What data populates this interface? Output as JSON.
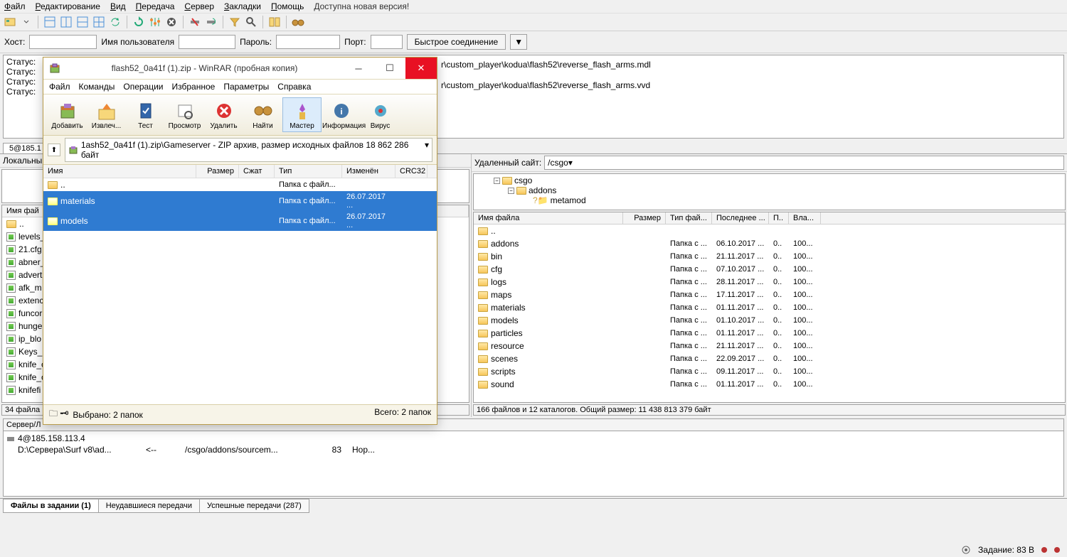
{
  "menu": {
    "file": "Файл",
    "edit": "Редактирование",
    "view": "Вид",
    "transfer": "Передача",
    "server": "Сервер",
    "bookmarks": "Закладки",
    "help": "Помощь",
    "update": "Доступна новая версия!"
  },
  "conn": {
    "host": "Хост:",
    "user": "Имя пользователя",
    "pass": "Пароль:",
    "port": "Порт:",
    "quick": "Быстрое соединение"
  },
  "status": {
    "l0": "Статус:",
    "l1": "Статус:",
    "l2": "Статус:",
    "l3": "Статус:",
    "r0": "r\\custom_player\\kodua\\flash52\\reverse_flash_arms.mdl",
    "r1": "r\\custom_player\\kodua\\flash52\\reverse_flash_arms.vvd"
  },
  "conntab": "5@185.1",
  "leftpane": {
    "label": "Локальны",
    "hdr": "Имя фай",
    "rows": [
      "..",
      "levels_",
      "21.cfg",
      "abner_",
      "advert",
      "afk_m",
      "extenc",
      "funcor",
      "hunge",
      "ip_blo",
      "Keys_C",
      "knife_c",
      "knife_c",
      "knifefi"
    ],
    "status": "34 файла"
  },
  "rightpane": {
    "label": "Удаленный сайт:",
    "path": "/csgo",
    "tree": {
      "root": "csgo",
      "c1": "addons",
      "c2": "metamod"
    },
    "hdr": {
      "c0": "Имя файла",
      "c1": "Размер",
      "c2": "Тип фай...",
      "c3": "Последнее ...",
      "c4": "П..",
      "c5": "Вла..."
    },
    "rows": [
      {
        "n": "..",
        "t": "",
        "d": "",
        "p": "",
        "o": ""
      },
      {
        "n": "addons",
        "t": "Папка с ...",
        "d": "06.10.2017 ...",
        "p": "0..",
        "o": "100..."
      },
      {
        "n": "bin",
        "t": "Папка с ...",
        "d": "21.11.2017 ...",
        "p": "0..",
        "o": "100..."
      },
      {
        "n": "cfg",
        "t": "Папка с ...",
        "d": "07.10.2017 ...",
        "p": "0..",
        "o": "100..."
      },
      {
        "n": "logs",
        "t": "Папка с ...",
        "d": "28.11.2017 ...",
        "p": "0..",
        "o": "100..."
      },
      {
        "n": "maps",
        "t": "Папка с ...",
        "d": "17.11.2017 ...",
        "p": "0..",
        "o": "100..."
      },
      {
        "n": "materials",
        "t": "Папка с ...",
        "d": "01.11.2017 ...",
        "p": "0..",
        "o": "100..."
      },
      {
        "n": "models",
        "t": "Папка с ...",
        "d": "01.10.2017 ...",
        "p": "0..",
        "o": "100..."
      },
      {
        "n": "particles",
        "t": "Папка с ...",
        "d": "01.11.2017 ...",
        "p": "0..",
        "o": "100..."
      },
      {
        "n": "resource",
        "t": "Папка с ...",
        "d": "21.11.2017 ...",
        "p": "0..",
        "o": "100..."
      },
      {
        "n": "scenes",
        "t": "Папка с ...",
        "d": "22.09.2017 ...",
        "p": "0..",
        "o": "100..."
      },
      {
        "n": "scripts",
        "t": "Папка с ...",
        "d": "09.11.2017 ...",
        "p": "0..",
        "o": "100..."
      },
      {
        "n": "sound",
        "t": "Папка с ...",
        "d": "01.11.2017 ...",
        "p": "0..",
        "o": "100..."
      }
    ],
    "status": "166 файлов и 12 каталогов. Общий размер: 11 438 813 379 байт"
  },
  "queue": {
    "header": "Сервер/Л",
    "srv": "4@185.158.113.4",
    "local": "D:\\Сервера\\Surf v8\\ad...",
    "dir": "<--",
    "remote": "/csgo/addons/sourcem...",
    "size": "83",
    "st": "Нор..."
  },
  "tabs": {
    "t0": "Файлы в задании  (1)",
    "t1": "Неудавшиеся передачи",
    "t2": "Успешные передачи (287)"
  },
  "foot": {
    "task": "Задание: 83 В"
  },
  "winrar": {
    "title": "flash52_0a41f (1).zip - WinRAR (пробная копия)",
    "menu": {
      "m0": "Файл",
      "m1": "Команды",
      "m2": "Операции",
      "m3": "Избранное",
      "m4": "Параметры",
      "m5": "Справка"
    },
    "tb": {
      "t0": "Добавить",
      "t1": "Извлеч...",
      "t2": "Тест",
      "t3": "Просмотр",
      "t4": "Удалить",
      "t5": "Найти",
      "t6": "Мастер",
      "t7": "Информация",
      "t8": "Вирус"
    },
    "path": "1ash52_0a41f (1).zip\\Gameserver - ZIP архив, размер исходных файлов 18 862 286 байт",
    "hdr": {
      "c0": "Имя",
      "c1": "Размер",
      "c2": "Сжат",
      "c3": "Тип",
      "c4": "Изменён",
      "c5": "CRC32"
    },
    "rows": [
      {
        "n": "..",
        "t": "Папка с файл...",
        "d": ""
      },
      {
        "n": "materials",
        "t": "Папка с файл...",
        "d": "26.07.2017 ..."
      },
      {
        "n": "models",
        "t": "Папка с файл...",
        "d": "26.07.2017 ..."
      }
    ],
    "status": {
      "l": "Выбрано: 2 папок",
      "r": "Всего: 2 папок"
    }
  }
}
